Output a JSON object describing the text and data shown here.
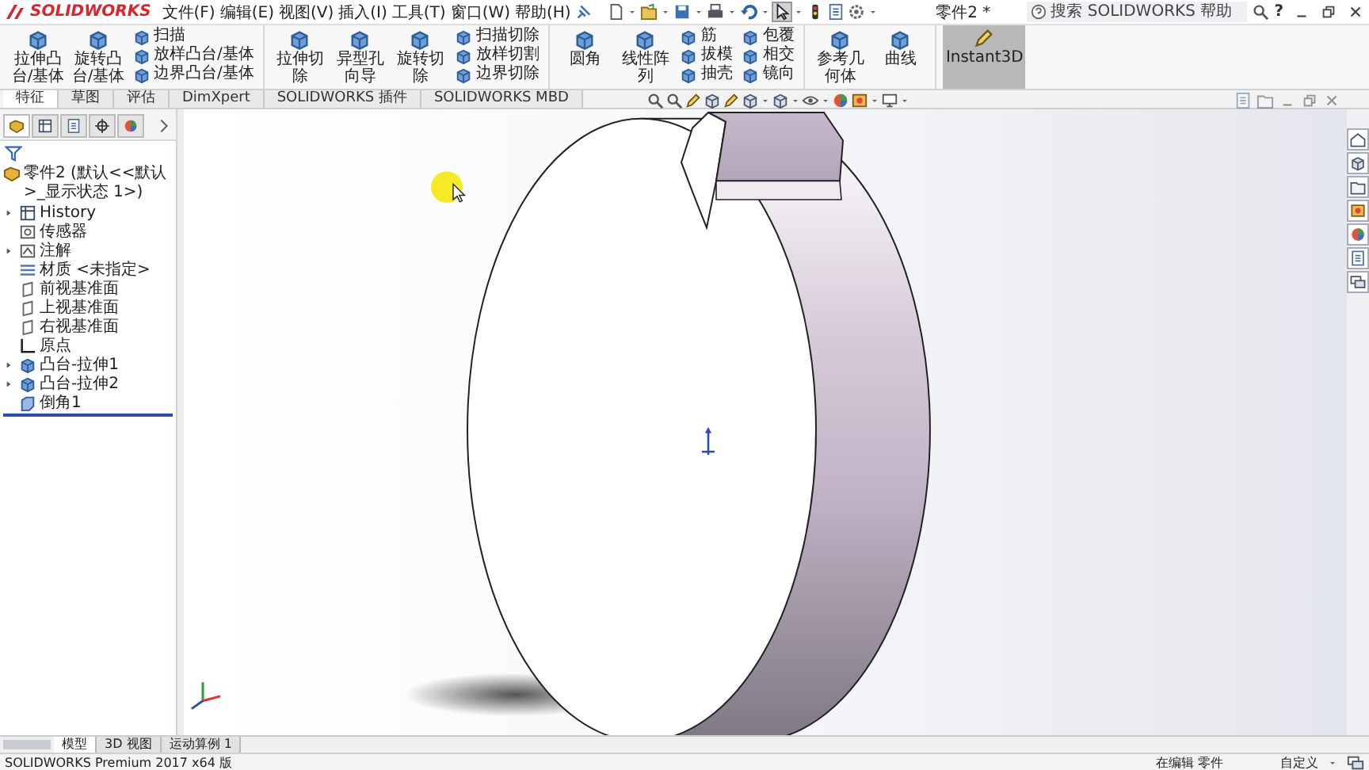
{
  "app": {
    "logo": "SOLIDWORKS",
    "menu": [
      "文件(F)",
      "编辑(E)",
      "视图(V)",
      "插入(I)",
      "工具(T)",
      "窗口(W)",
      "帮助(H)"
    ],
    "document_title": "零件2 *",
    "help_search": {
      "placeholder": "搜索 SOLIDWORKS 帮助"
    },
    "help_button": "?"
  },
  "ribbon": {
    "groups": [
      [
        {
          "kind": "large",
          "label": "拉伸凸台/基体"
        },
        {
          "kind": "large",
          "label": "旋转凸台/基体"
        },
        {
          "kind": "stack",
          "items": [
            "扫描",
            "放样凸台/基体",
            "边界凸台/基体"
          ]
        }
      ],
      [
        {
          "kind": "large",
          "label": "拉伸切除"
        },
        {
          "kind": "large",
          "label": "异型孔向导"
        },
        {
          "kind": "large",
          "label": "旋转切除"
        },
        {
          "kind": "stack",
          "items": [
            "扫描切除",
            "放样切割",
            "边界切除"
          ]
        }
      ],
      [
        {
          "kind": "large",
          "label": "圆角"
        },
        {
          "kind": "large",
          "label": "线性阵列"
        },
        {
          "kind": "stack",
          "items": [
            "筋",
            "拔模",
            "抽壳"
          ]
        },
        {
          "kind": "stack",
          "items": [
            "包覆",
            "相交",
            "镜向"
          ]
        }
      ],
      [
        {
          "kind": "large",
          "label": "参考几何体"
        },
        {
          "kind": "large",
          "label": "曲线"
        }
      ]
    ],
    "instant3d": {
      "label": "Instant3D",
      "on": true
    }
  },
  "command_tabs": [
    {
      "label": "特征",
      "selected": true
    },
    {
      "label": "草图",
      "selected": false
    },
    {
      "label": "评估",
      "selected": false
    },
    {
      "label": "DimXpert",
      "selected": false
    },
    {
      "label": "SOLIDWORKS 插件",
      "selected": false
    },
    {
      "label": "SOLIDWORKS MBD",
      "selected": false
    }
  ],
  "feature_tree": {
    "root": {
      "kind": "part",
      "label": "零件2  (默认<<默认>_显示状态 1>)",
      "children": [
        {
          "kind": "history",
          "label": "History",
          "expanded": false
        },
        {
          "kind": "sensor",
          "label": "传感器"
        },
        {
          "kind": "annotation",
          "label": "注解",
          "expanded": false
        },
        {
          "kind": "material",
          "label": "材质 <未指定>"
        },
        {
          "kind": "plane",
          "label": "前视基准面"
        },
        {
          "kind": "plane",
          "label": "上视基准面"
        },
        {
          "kind": "plane",
          "label": "右视基准面"
        },
        {
          "kind": "origin",
          "label": "原点"
        },
        {
          "kind": "feature",
          "label": "凸台-拉伸1",
          "expanded": false
        },
        {
          "kind": "feature",
          "label": "凸台-拉伸2",
          "expanded": false
        },
        {
          "kind": "chamfer",
          "label": "倒角1"
        }
      ]
    }
  },
  "bottom_tabs": [
    {
      "label": "模型",
      "selected": true
    },
    {
      "label": "3D 视图",
      "selected": false
    },
    {
      "label": "运动算例 1",
      "selected": false
    }
  ],
  "status_bar": {
    "product": "SOLIDWORKS Premium 2017 x64 版",
    "mode": "在编辑 零件",
    "units": "自定义"
  }
}
